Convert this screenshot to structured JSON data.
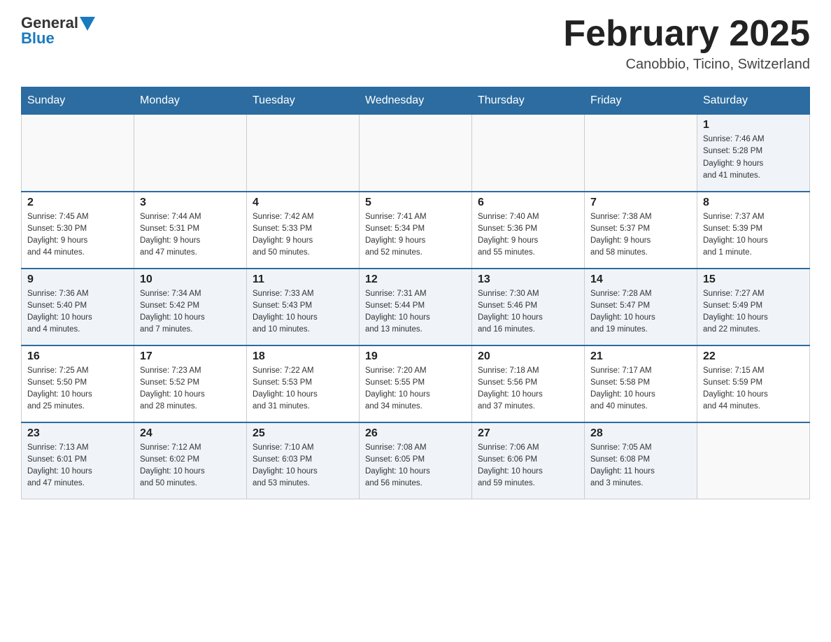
{
  "header": {
    "logo": {
      "general": "General",
      "blue": "Blue"
    },
    "title": "February 2025",
    "location": "Canobbio, Ticino, Switzerland"
  },
  "weekdays": [
    "Sunday",
    "Monday",
    "Tuesday",
    "Wednesday",
    "Thursday",
    "Friday",
    "Saturday"
  ],
  "weeks": [
    {
      "days": [
        {
          "number": "",
          "info": ""
        },
        {
          "number": "",
          "info": ""
        },
        {
          "number": "",
          "info": ""
        },
        {
          "number": "",
          "info": ""
        },
        {
          "number": "",
          "info": ""
        },
        {
          "number": "",
          "info": ""
        },
        {
          "number": "1",
          "info": "Sunrise: 7:46 AM\nSunset: 5:28 PM\nDaylight: 9 hours\nand 41 minutes."
        }
      ]
    },
    {
      "days": [
        {
          "number": "2",
          "info": "Sunrise: 7:45 AM\nSunset: 5:30 PM\nDaylight: 9 hours\nand 44 minutes."
        },
        {
          "number": "3",
          "info": "Sunrise: 7:44 AM\nSunset: 5:31 PM\nDaylight: 9 hours\nand 47 minutes."
        },
        {
          "number": "4",
          "info": "Sunrise: 7:42 AM\nSunset: 5:33 PM\nDaylight: 9 hours\nand 50 minutes."
        },
        {
          "number": "5",
          "info": "Sunrise: 7:41 AM\nSunset: 5:34 PM\nDaylight: 9 hours\nand 52 minutes."
        },
        {
          "number": "6",
          "info": "Sunrise: 7:40 AM\nSunset: 5:36 PM\nDaylight: 9 hours\nand 55 minutes."
        },
        {
          "number": "7",
          "info": "Sunrise: 7:38 AM\nSunset: 5:37 PM\nDaylight: 9 hours\nand 58 minutes."
        },
        {
          "number": "8",
          "info": "Sunrise: 7:37 AM\nSunset: 5:39 PM\nDaylight: 10 hours\nand 1 minute."
        }
      ]
    },
    {
      "days": [
        {
          "number": "9",
          "info": "Sunrise: 7:36 AM\nSunset: 5:40 PM\nDaylight: 10 hours\nand 4 minutes."
        },
        {
          "number": "10",
          "info": "Sunrise: 7:34 AM\nSunset: 5:42 PM\nDaylight: 10 hours\nand 7 minutes."
        },
        {
          "number": "11",
          "info": "Sunrise: 7:33 AM\nSunset: 5:43 PM\nDaylight: 10 hours\nand 10 minutes."
        },
        {
          "number": "12",
          "info": "Sunrise: 7:31 AM\nSunset: 5:44 PM\nDaylight: 10 hours\nand 13 minutes."
        },
        {
          "number": "13",
          "info": "Sunrise: 7:30 AM\nSunset: 5:46 PM\nDaylight: 10 hours\nand 16 minutes."
        },
        {
          "number": "14",
          "info": "Sunrise: 7:28 AM\nSunset: 5:47 PM\nDaylight: 10 hours\nand 19 minutes."
        },
        {
          "number": "15",
          "info": "Sunrise: 7:27 AM\nSunset: 5:49 PM\nDaylight: 10 hours\nand 22 minutes."
        }
      ]
    },
    {
      "days": [
        {
          "number": "16",
          "info": "Sunrise: 7:25 AM\nSunset: 5:50 PM\nDaylight: 10 hours\nand 25 minutes."
        },
        {
          "number": "17",
          "info": "Sunrise: 7:23 AM\nSunset: 5:52 PM\nDaylight: 10 hours\nand 28 minutes."
        },
        {
          "number": "18",
          "info": "Sunrise: 7:22 AM\nSunset: 5:53 PM\nDaylight: 10 hours\nand 31 minutes."
        },
        {
          "number": "19",
          "info": "Sunrise: 7:20 AM\nSunset: 5:55 PM\nDaylight: 10 hours\nand 34 minutes."
        },
        {
          "number": "20",
          "info": "Sunrise: 7:18 AM\nSunset: 5:56 PM\nDaylight: 10 hours\nand 37 minutes."
        },
        {
          "number": "21",
          "info": "Sunrise: 7:17 AM\nSunset: 5:58 PM\nDaylight: 10 hours\nand 40 minutes."
        },
        {
          "number": "22",
          "info": "Sunrise: 7:15 AM\nSunset: 5:59 PM\nDaylight: 10 hours\nand 44 minutes."
        }
      ]
    },
    {
      "days": [
        {
          "number": "23",
          "info": "Sunrise: 7:13 AM\nSunset: 6:01 PM\nDaylight: 10 hours\nand 47 minutes."
        },
        {
          "number": "24",
          "info": "Sunrise: 7:12 AM\nSunset: 6:02 PM\nDaylight: 10 hours\nand 50 minutes."
        },
        {
          "number": "25",
          "info": "Sunrise: 7:10 AM\nSunset: 6:03 PM\nDaylight: 10 hours\nand 53 minutes."
        },
        {
          "number": "26",
          "info": "Sunrise: 7:08 AM\nSunset: 6:05 PM\nDaylight: 10 hours\nand 56 minutes."
        },
        {
          "number": "27",
          "info": "Sunrise: 7:06 AM\nSunset: 6:06 PM\nDaylight: 10 hours\nand 59 minutes."
        },
        {
          "number": "28",
          "info": "Sunrise: 7:05 AM\nSunset: 6:08 PM\nDaylight: 11 hours\nand 3 minutes."
        },
        {
          "number": "",
          "info": ""
        }
      ]
    }
  ]
}
